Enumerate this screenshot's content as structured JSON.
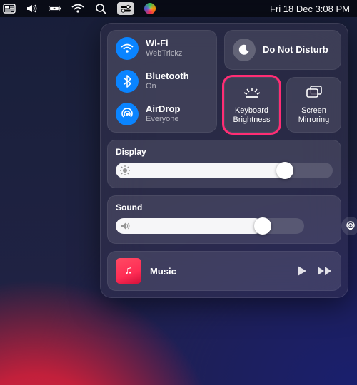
{
  "menubar": {
    "datetime": "Fri 18 Dec  3:08 PM"
  },
  "cc": {
    "wifi": {
      "title": "Wi-Fi",
      "sub": "WebTrickz"
    },
    "bluetooth": {
      "title": "Bluetooth",
      "sub": "On"
    },
    "airdrop": {
      "title": "AirDrop",
      "sub": "Everyone"
    },
    "dnd": {
      "label": "Do Not Disturb"
    },
    "kb": {
      "label": "Keyboard Brightness"
    },
    "mirror": {
      "label": "Screen Mirroring"
    },
    "display": {
      "title": "Display",
      "percent": 78
    },
    "sound": {
      "title": "Sound",
      "percent": 78
    },
    "music": {
      "title": "Music"
    }
  },
  "colors": {
    "accent_blue": "#0a84ff",
    "highlight": "#ff2d74"
  }
}
